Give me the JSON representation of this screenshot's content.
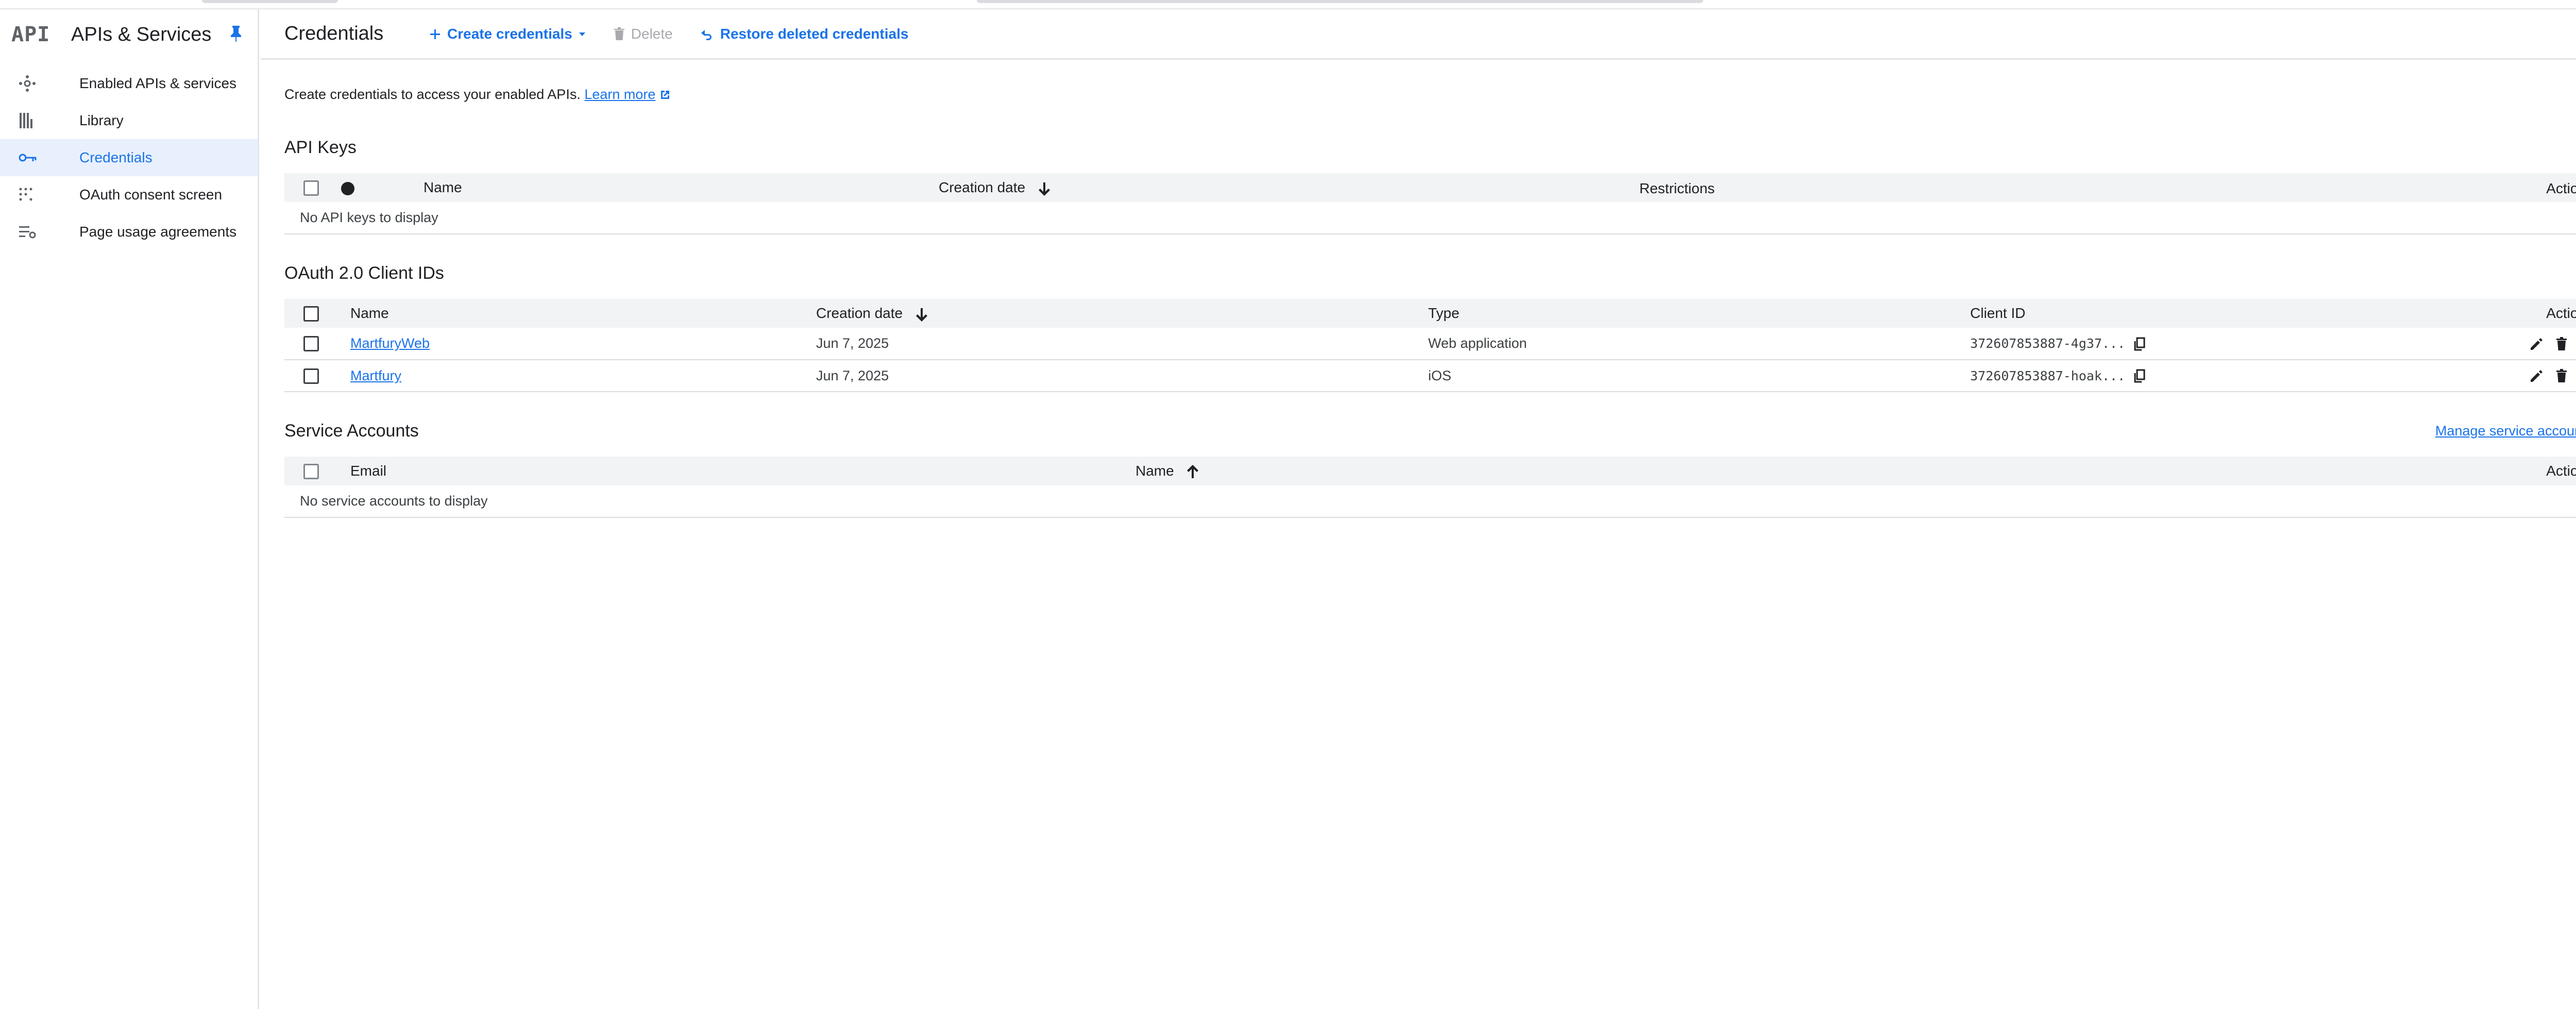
{
  "sidebar": {
    "logo": "API",
    "title": "APIs & Services",
    "items": [
      {
        "label": "Enabled APIs & services",
        "icon": "hub-icon"
      },
      {
        "label": "Library",
        "icon": "library-icon"
      },
      {
        "label": "Credentials",
        "icon": "key-icon",
        "active": true
      },
      {
        "label": "OAuth consent screen",
        "icon": "consent-icon"
      },
      {
        "label": "Page usage agreements",
        "icon": "settings-list-icon"
      }
    ]
  },
  "header": {
    "title": "Credentials",
    "create_label": "Create credentials",
    "delete_label": "Delete",
    "restore_label": "Restore deleted credentials"
  },
  "intro": {
    "text": "Create credentials to access your enabled APIs.",
    "learn_more": "Learn more"
  },
  "api_keys": {
    "title": "API Keys",
    "columns": {
      "name": "Name",
      "creation_date": "Creation date",
      "restrictions": "Restrictions",
      "actions": "Actions"
    },
    "empty": "No API keys to display"
  },
  "oauth": {
    "title": "OAuth 2.0 Client IDs",
    "columns": {
      "name": "Name",
      "creation_date": "Creation date",
      "type": "Type",
      "client_id": "Client ID",
      "actions": "Actions"
    },
    "rows": [
      {
        "name": "MartfuryWeb",
        "date": "Jun 7, 2025",
        "type": "Web application",
        "client_id": "372607853887-4g37..."
      },
      {
        "name": "Martfury",
        "date": "Jun 7, 2025",
        "type": "iOS",
        "client_id": "372607853887-hoak..."
      }
    ]
  },
  "service_accounts": {
    "title": "Service Accounts",
    "manage_label": "Manage service accounts",
    "columns": {
      "email": "Email",
      "name": "Name",
      "actions": "Actions"
    },
    "empty": "No service accounts to display"
  },
  "colors": {
    "accent": "#1a73e8",
    "active_bg": "#e8f0fe",
    "header_bg": "#f1f3f4"
  }
}
